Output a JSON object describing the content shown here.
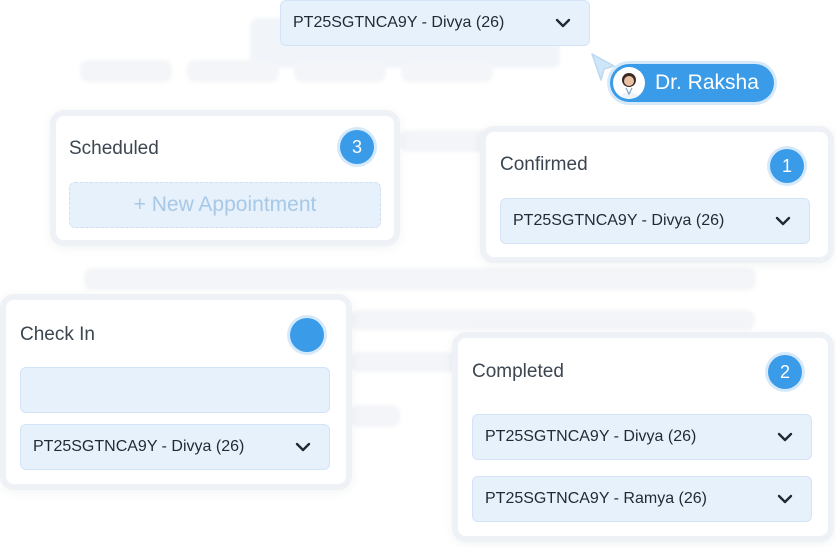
{
  "top_select": {
    "value": "PT25SGTNCA9Y - Divya (26)"
  },
  "doctor": {
    "name": "Dr. Raksha",
    "icon": "doctor-avatar-icon"
  },
  "columns": {
    "scheduled": {
      "title": "Scheduled",
      "count": "3",
      "new_label": "+ New Appointment"
    },
    "confirmed": {
      "title": "Confirmed",
      "count": "1",
      "items": [
        "PT25SGTNCA9Y - Divya (26)"
      ]
    },
    "check_in": {
      "title": "Check In",
      "count": "",
      "items": [
        "PT25SGTNCA9Y - Divya (26)"
      ]
    },
    "completed": {
      "title": "Completed",
      "count": "2",
      "items": [
        "PT25SGTNCA9Y - Divya (26)",
        "PT25SGTNCA9Y - Ramya (26)"
      ]
    }
  },
  "colors": {
    "accent": "#3a9be8",
    "select_bg": "#e6f1fc",
    "card_border": "#eef1f5"
  }
}
